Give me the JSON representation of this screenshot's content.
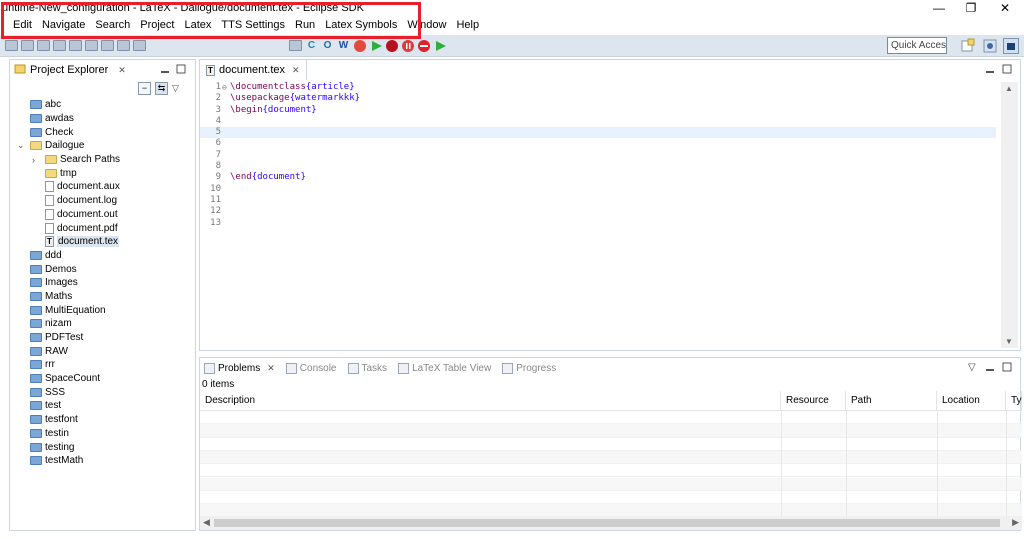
{
  "window": {
    "title": "untime-New_configuration - LaTeX - Dailogue/document.tex - Eclipse SDK",
    "minimize_glyph": "—",
    "restore_glyph": "❐",
    "close_glyph": "✕"
  },
  "menu": [
    "Edit",
    "Navigate",
    "Search",
    "Project",
    "Latex",
    "TTS Settings",
    "Run",
    "Latex Symbols",
    "Window",
    "Help"
  ],
  "toolbar": {
    "quick_access_placeholder": "Quick Access",
    "icons": [
      "save-icon",
      "run-icon",
      "debug-icon",
      "new-icon",
      "open-icon",
      "back-icon",
      "forward-icon",
      "build-icon",
      "refresh-icon",
      "latex-icon",
      "c-icon",
      "o-icon",
      "w-icon",
      "stop-icon",
      "play-icon",
      "record-icon",
      "pause-icon",
      "stop-sign-icon",
      "play2-icon"
    ]
  },
  "explorer": {
    "title": "Project Explorer",
    "close_glyph": "✕",
    "items": [
      {
        "label": "abc",
        "type": "folder",
        "level": 0
      },
      {
        "label": "awdas",
        "type": "folder",
        "level": 0
      },
      {
        "label": "Check",
        "type": "folder",
        "level": 0
      },
      {
        "label": "Dailogue",
        "type": "folder-open",
        "level": 0,
        "expanded": true
      },
      {
        "label": "Search Paths",
        "type": "folder-open",
        "level": 1,
        "collapsed": true
      },
      {
        "label": "tmp",
        "type": "folder-open",
        "level": 1
      },
      {
        "label": "document.aux",
        "type": "file",
        "level": 1
      },
      {
        "label": "document.log",
        "type": "file",
        "level": 1
      },
      {
        "label": "document.out",
        "type": "file",
        "level": 1
      },
      {
        "label": "document.pdf",
        "type": "file",
        "level": 1
      },
      {
        "label": "document.tex",
        "type": "tex",
        "level": 1,
        "selected": true
      },
      {
        "label": "ddd",
        "type": "folder",
        "level": 0
      },
      {
        "label": "Demos",
        "type": "folder",
        "level": 0
      },
      {
        "label": "Images",
        "type": "folder",
        "level": 0
      },
      {
        "label": "Maths",
        "type": "folder",
        "level": 0
      },
      {
        "label": "MultiEquation",
        "type": "folder",
        "level": 0
      },
      {
        "label": "nizam",
        "type": "folder",
        "level": 0
      },
      {
        "label": "PDFTest",
        "type": "folder",
        "level": 0
      },
      {
        "label": "RAW",
        "type": "folder",
        "level": 0
      },
      {
        "label": "rrr",
        "type": "folder",
        "level": 0
      },
      {
        "label": "SpaceCount",
        "type": "folder",
        "level": 0
      },
      {
        "label": "SSS",
        "type": "folder",
        "level": 0
      },
      {
        "label": "test",
        "type": "folder",
        "level": 0
      },
      {
        "label": "testfont",
        "type": "folder",
        "level": 0
      },
      {
        "label": "testin",
        "type": "folder",
        "level": 0
      },
      {
        "label": "testing",
        "type": "folder",
        "level": 0
      },
      {
        "label": "testMath",
        "type": "folder",
        "level": 0
      }
    ]
  },
  "editor": {
    "tab_label": "document.tex",
    "current_line": 5,
    "lines": [
      {
        "n": "1",
        "marker": "⊖",
        "cmd": "\\documentclass",
        "arg": "{article}"
      },
      {
        "n": "2",
        "cmd": "\\usepackage",
        "arg": "{watermarkkk}"
      },
      {
        "n": "3",
        "cmd": "\\begin",
        "arg": "{document}"
      },
      {
        "n": "4"
      },
      {
        "n": "5"
      },
      {
        "n": "6"
      },
      {
        "n": "7"
      },
      {
        "n": "8"
      },
      {
        "n": "9",
        "cmd": "\\end",
        "arg": "{document}"
      },
      {
        "n": "10"
      },
      {
        "n": "11"
      },
      {
        "n": "12"
      },
      {
        "n": "13"
      }
    ]
  },
  "problems": {
    "tabs": [
      {
        "label": "Problems",
        "active": true
      },
      {
        "label": "Console"
      },
      {
        "label": "Tasks"
      },
      {
        "label": "LaTeX Table View"
      },
      {
        "label": "Progress"
      }
    ],
    "items_count": "0 items",
    "columns": [
      "Description",
      "Resource",
      "Path",
      "Location",
      "Ty"
    ]
  }
}
